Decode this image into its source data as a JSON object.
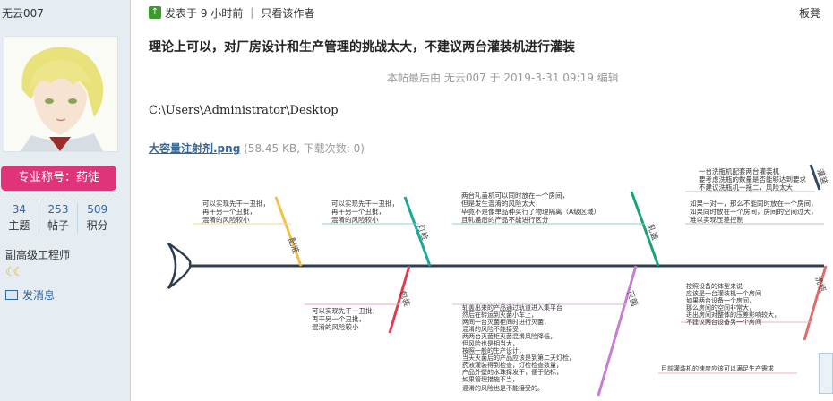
{
  "sidebar": {
    "username": "无云007",
    "title_badge": "专业称号：药徒",
    "stats": [
      {
        "value": "34",
        "label": "主题"
      },
      {
        "value": "253",
        "label": "帖子"
      },
      {
        "value": "509",
        "label": "积分"
      }
    ],
    "rank": "副高级工程师",
    "message_link": "发消息"
  },
  "post": {
    "posted_time": "发表于 9 小时前",
    "author_only": "只看该作者",
    "floor_label": "板凳",
    "title": "理论上可以，对厂房设计和生产管理的挑战太大，不建议两台灌装机进行灌装",
    "edit_note": "本帖最后由 无云007 于 2019-3-31 09:19 编辑",
    "path": "C:\\Users\\Administrator\\Desktop",
    "attachment": {
      "name": "大容量注射剂.png",
      "info": "(58.45 KB, 下载次数: 0)"
    }
  },
  "diagram": {
    "bones_top": [
      {
        "label": "配液",
        "lines": [
          "可以实现先干一丑批，",
          "再干另一个丑批，",
          "混淆的风险较小"
        ]
      },
      {
        "label": "灯检",
        "lines": [
          "可以实现先干一丑批，",
          "再干另一个丑批，",
          "混淆的风险较小"
        ]
      },
      {
        "label": "轧盖",
        "lines": [
          "两台轧盖机可以同时放在一个房间，",
          "但是发生混淆的风险太大，",
          "毕竟不是像单品种买行了物理隔离（A级区域）",
          "且轧盖后的产品不能进行区分"
        ]
      },
      {
        "label": "灌装",
        "lines": [
          "一台洗瓶机配套两台灌装机",
          "要考虑洗瓶的数量是否能够达到要求",
          "不建议洗瓶机一拖二，风险太大",
          "如果一对一，那么不能同时放在一个房间，",
          "如果同时放在一个房间，房间的空间过大，",
          "难以实现压差控制"
        ]
      }
    ],
    "bones_bottom": [
      {
        "label": "包装",
        "lines": [
          "可以实现先干一丑批，",
          "再干另一个丑批，",
          "混淆的风险较小"
        ]
      },
      {
        "label": "灭菌",
        "lines": [
          "轧盖出来的产品通过轨道进入集平台",
          "然后在转运到灭菌小车上，",
          "两同一台灭菌柜同时进行灭菌，",
          "混淆的风险不能接受；",
          "两两台灭菌柜灭菌混淆风险降低，",
          "但风险也是相当大，",
          "按照一般的生产设计，",
          "当天灭菌后的产品应该是到第二天灯检，",
          "药液灌装得到检查，灯检检查数量，",
          "产品外壁的水珠挥发干，便于贴标，",
          "如果管理措施不当，",
          "混淆的风险也是不能接受的。"
        ]
      },
      {
        "label": "洗瓶",
        "lines": [
          "按照设备的体型来说",
          "应该是一台灌装机一个房间",
          "如果两台设备一个房间，",
          "那么房间的空间非常大，",
          "进出房间对整体的压差影响较大，",
          "不建议两台设备另一个房间",
          "目前灌装机的速度应该可以满足生产需求"
        ]
      }
    ]
  }
}
